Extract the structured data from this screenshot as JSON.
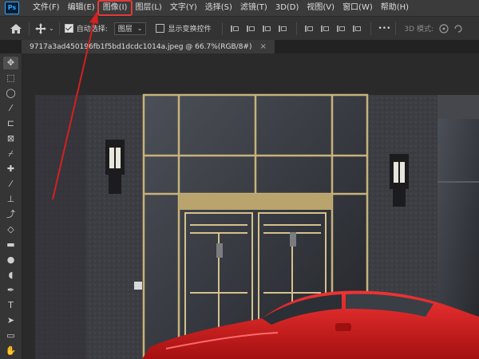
{
  "app": {
    "logo_text": "Ps"
  },
  "menu": {
    "items": [
      "文件(F)",
      "编辑(E)",
      "图像(I)",
      "图层(L)",
      "文字(Y)",
      "选择(S)",
      "滤镜(T)",
      "3D(D)",
      "视图(V)",
      "窗口(W)",
      "帮助(H)"
    ],
    "highlighted": "图像(I)"
  },
  "options": {
    "auto_select_label": "自动选择:",
    "auto_select_checked": true,
    "layer_select_value": "图层",
    "show_transform_label": "显示变换控件",
    "show_transform_checked": false,
    "mode_3d_label": "3D 模式:",
    "more_label": "•••"
  },
  "document": {
    "tab_title": "9717a3ad450196fb1f5bd1dcdc1014a.jpeg @ 66.7%(RGB/8#)",
    "close_glyph": "×"
  },
  "toolbar": {
    "tools": [
      "move-tool",
      "marquee-tool",
      "lasso-tool",
      "magic-wand-tool",
      "crop-tool",
      "frame-tool",
      "eyedropper-tool",
      "healing-brush-tool",
      "brush-tool",
      "clone-stamp-tool",
      "history-brush-tool",
      "eraser-tool",
      "gradient-tool",
      "blur-tool",
      "dodge-tool",
      "pen-tool",
      "type-tool",
      "path-selection-tool",
      "rectangle-tool",
      "hand-tool"
    ]
  },
  "colors": {
    "highlight": "#e23a3a",
    "arrow": "#d42020",
    "car": "#d91c1c",
    "door_frame": "#c7b27a"
  }
}
